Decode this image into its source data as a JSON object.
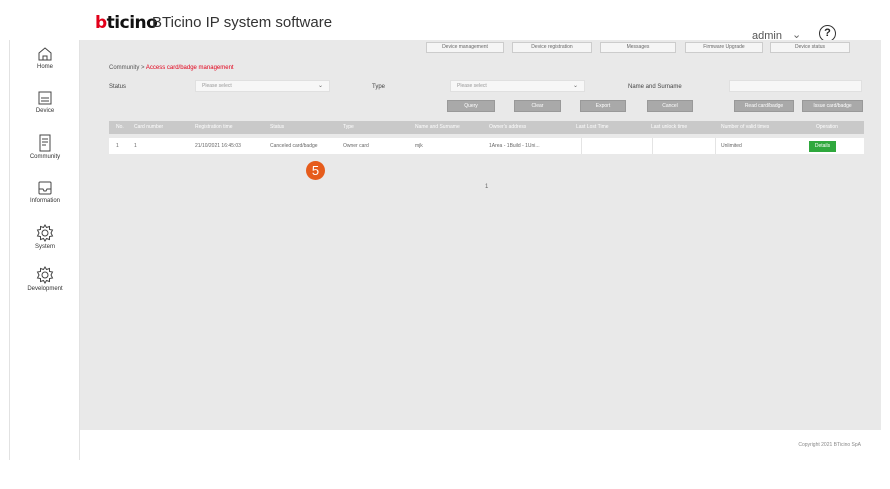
{
  "header": {
    "logo_text": "bticino",
    "app_title": "BTicino IP system software",
    "user": "admin",
    "help_symbol": "?"
  },
  "sidebar": {
    "items": [
      {
        "label": "Home",
        "icon": "home-icon"
      },
      {
        "label": "Device",
        "icon": "device-icon"
      },
      {
        "label": "Community",
        "icon": "community-icon"
      },
      {
        "label": "Information",
        "icon": "information-icon"
      },
      {
        "label": "System",
        "icon": "gear-icon"
      },
      {
        "label": "Development",
        "icon": "gear-icon"
      }
    ]
  },
  "topnav": {
    "items": [
      {
        "label": "Device management"
      },
      {
        "label": "Device registration"
      },
      {
        "label": "Messages"
      },
      {
        "label": "Firmware Upgrade"
      },
      {
        "label": "Device status"
      }
    ]
  },
  "breadcrumb": {
    "parent": "Community",
    "current": "Access card/badge management"
  },
  "filters": {
    "status_label": "Status",
    "status_value": "Please select",
    "type_label": "Type",
    "type_value": "Please select",
    "name_label": "Name and Surname",
    "name_value": ""
  },
  "actions": {
    "query": "Query",
    "clear": "Clear",
    "export": "Export",
    "cancel": "Cancel",
    "read": "Read card/badge",
    "issue": "Issue card/badge"
  },
  "table": {
    "columns": [
      "No.",
      "Card number",
      "Registration time",
      "Status",
      "Type",
      "Name and Surname",
      "Owner's address",
      "Last Lost Time",
      "Last unlock time",
      "Number of valid times",
      "Operation"
    ],
    "rows": [
      {
        "no": "1",
        "card_number": "1",
        "registration_time": "21/10/2021 16:45:03",
        "status": "Canceled card/badge",
        "type": "Owner card",
        "name": "mjk",
        "address": "1Area - 1Build - 1Uni...",
        "last_lost": "",
        "last_unlock": "",
        "valid_times": "Unlimited",
        "operation": "Details"
      }
    ]
  },
  "annotation_marker": "5",
  "pagination": {
    "page": "1"
  },
  "footer": {
    "copyright": "Copyright 2021 BTicino SpA"
  },
  "colors": {
    "brand_red": "#e2001a",
    "content_bg": "#e9e9e9",
    "details_green": "#2fa83d",
    "marker_orange": "#e65c1c"
  }
}
